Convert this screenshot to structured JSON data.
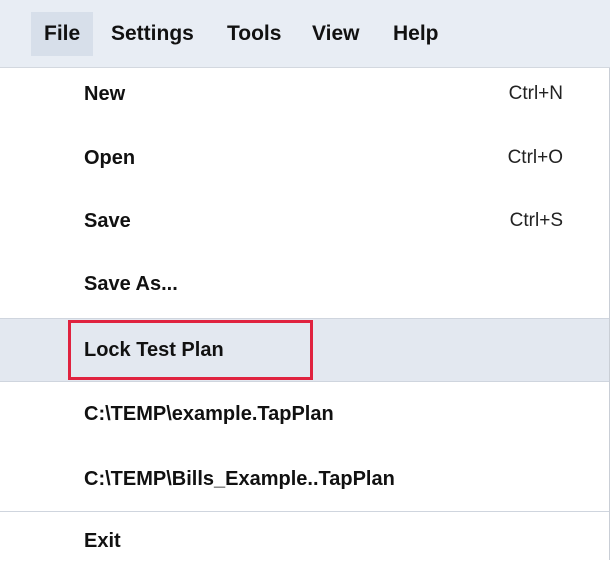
{
  "menubar": {
    "items": [
      "File",
      "Settings",
      "Tools",
      "View",
      "Help"
    ]
  },
  "file_menu": {
    "new": {
      "label": "New",
      "shortcut": "Ctrl+N"
    },
    "open": {
      "label": "Open",
      "shortcut": "Ctrl+O"
    },
    "save": {
      "label": "Save",
      "shortcut": "Ctrl+S"
    },
    "save_as": {
      "label": "Save As..."
    },
    "lock_test_plan": {
      "label": "Lock Test Plan"
    },
    "recent": [
      {
        "label": "C:\\TEMP\\example.TapPlan"
      },
      {
        "label": "C:\\TEMP\\Bills_Example..TapPlan"
      }
    ],
    "exit": {
      "label": "Exit"
    }
  },
  "colors": {
    "menubar_bg": "#e8edf4",
    "highlight_bg": "#e3e8f0",
    "annotation_red": "#e0223f"
  }
}
